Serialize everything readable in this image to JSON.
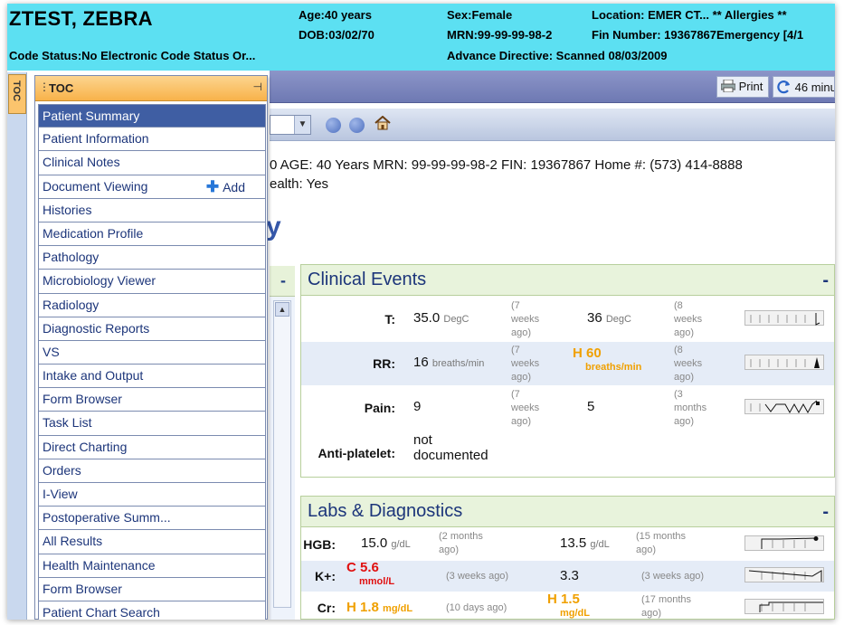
{
  "banner": {
    "patient_name": "ZTEST, ZEBRA",
    "age": "Age:40 years",
    "dob": "DOB:03/02/70",
    "sex": "Sex:Female",
    "mrn": "MRN:99-99-99-98-2",
    "location": "Location: EMER CT... ** Allergies **",
    "fin": "Fin Number: 19367867Emergency [4/1",
    "code_status": "Code Status:No Electronic Code Status Or...",
    "advance_directive": "Advance Directive:  Scanned 08/03/2009"
  },
  "toc_tab": "TOC",
  "toc": {
    "title": "TOC",
    "items": [
      {
        "label": "Patient Summary"
      },
      {
        "label": "Patient Information"
      },
      {
        "label": "Clinical Notes"
      },
      {
        "label": "Document Viewing",
        "action": "Add"
      },
      {
        "label": "Histories"
      },
      {
        "label": "Medication Profile"
      },
      {
        "label": "Pathology"
      },
      {
        "label": "Microbiology Viewer"
      },
      {
        "label": "Radiology"
      },
      {
        "label": "Diagnostic Reports"
      },
      {
        "label": "VS"
      },
      {
        "label": "Intake and Output"
      },
      {
        "label": "Form Browser"
      },
      {
        "label": "Task List"
      },
      {
        "label": "Direct Charting"
      },
      {
        "label": "Orders"
      },
      {
        "label": "I-View"
      },
      {
        "label": "Postoperative Summ..."
      },
      {
        "label": "All Results"
      },
      {
        "label": "Health Maintenance"
      },
      {
        "label": "Form Browser"
      },
      {
        "label": "Patient Chart Search"
      }
    ]
  },
  "toolbar": {
    "print_label": "Print",
    "refresh_label": "46 minu"
  },
  "patient_line": {
    "line1": "0   AGE: 40 Years    MRN: 99-99-99-98-2    FIN: 19367867    Home #: (573) 414-8888",
    "line2": "ealth: Yes",
    "partial_heading": "y"
  },
  "clinical_events": {
    "title": "Clinical Events",
    "min": "-",
    "rows": [
      {
        "label": "T:",
        "v1": "35.0",
        "u1": "DegC",
        "a1": "(7\nweeks\nago)",
        "v2": "36",
        "u2": "DegC",
        "a2": "(8\nweeks\nago)"
      },
      {
        "label": "RR:",
        "v1": "16",
        "u1": "breaths/min",
        "a1": "(7\nweeks\nago)",
        "flag2": "H",
        "v2": "60",
        "u2": "breaths/min",
        "a2": "(8\nweeks\nago)"
      },
      {
        "label": "Pain:",
        "v1": "9",
        "u1": "",
        "a1": "(7\nweeks\nago)",
        "v2": "5",
        "u2": "",
        "a2": "(3\nmonths\nago)"
      },
      {
        "label": "Anti-platelet:",
        "v1": "not\ndocumented"
      }
    ]
  },
  "labs": {
    "title": "Labs & Diagnostics",
    "min": "-",
    "rows": [
      {
        "label": "HGB:",
        "v1": "15.0",
        "u1": "g/dL",
        "a1": "(2 months\nago)",
        "v2": "13.5",
        "u2": "g/dL",
        "a2": "(15 months\nago)"
      },
      {
        "label": "K+:",
        "flag1": "C",
        "v1": "5.6",
        "u1": "mmol/L",
        "a1": "(3 weeks ago)",
        "v2": "3.3",
        "u2": "",
        "a2": "(3 weeks ago)"
      },
      {
        "label": "Cr:",
        "flag1": "H",
        "v1": "1.8",
        "u1": "mg/dL",
        "a1": "(10 days ago)",
        "flag2": "H",
        "v2": "1.5",
        "u2": "mg/dL",
        "a2": "(17 months\nago)"
      }
    ]
  },
  "colors": {
    "banner": "#5ce0f2",
    "toc_header": "#f8b24a",
    "toc_selected": "#3f5ea3",
    "high_flag": "#f0a000",
    "critical_flag": "#e01010",
    "section_header": "#e8f3dc"
  },
  "icons": [
    "print-icon",
    "refresh-icon",
    "home-icon",
    "back-icon",
    "forward-icon",
    "pin-icon",
    "add-icon",
    "collapse-icon",
    "scroll-up-icon"
  ]
}
